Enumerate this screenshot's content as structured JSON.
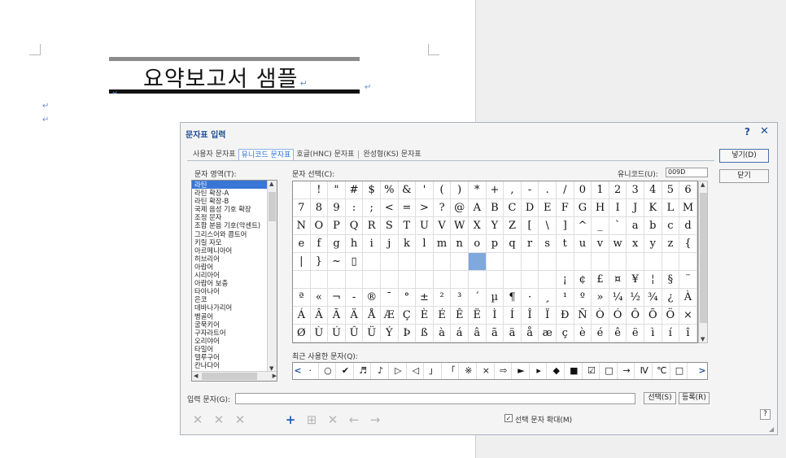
{
  "document": {
    "title": "요약보고서 샘플",
    "para_mark": "↵"
  },
  "dialog": {
    "title": "문자표 입력",
    "help": "?",
    "close": "✕",
    "tabs": [
      "사용자 문자표",
      "유니코드 문자표",
      "호글(HNC) 문자표",
      "완성형(KS) 문자표"
    ],
    "active_tab": 1,
    "insert_button": "넣기(D)",
    "close_button": "닫기",
    "area_label": "문자 영역(T):",
    "select_label": "문자 선택(C):",
    "unicode_label": "유니코드(U):",
    "unicode_value": "009D",
    "recent_label": "최근 사용한 문자(Q):",
    "input_label": "입력 문자(G):",
    "input_value": "",
    "select_button": "선택(S)",
    "register_button": "등록(R)",
    "zoom_label": "선택 문자 확대(M)",
    "zoom_checked": "✓",
    "corner_help": "?",
    "areas": [
      "라틴",
      "라틴 확장-A",
      "라틴 확장-B",
      "국제 음성 기호 확장",
      "조정 문자",
      "조합 분음 기호(악센트)",
      "그리스어와 콥트어",
      "키릴 자모",
      "아르메니아어",
      "히브리어",
      "아랍어",
      "시리아어",
      "아랍어 보충",
      "타아나어",
      "은코",
      "데바나가리어",
      "벵골어",
      "굴묵키어",
      "구자라트어",
      "오리야어",
      "타밀어",
      "텔루구어",
      "칸나다어"
    ],
    "selected_area": 0,
    "grid_rows": [
      [
        "",
        "!",
        "\"",
        "#",
        "$",
        "%",
        "&",
        "'",
        "(",
        ")",
        "*",
        "+",
        ",",
        "-",
        ".",
        "/",
        "0",
        "1",
        "2",
        "3",
        "4",
        "5",
        "6"
      ],
      [
        "7",
        "8",
        "9",
        ":",
        ";",
        "<",
        "=",
        ">",
        "?",
        "@",
        "A",
        "B",
        "C",
        "D",
        "E",
        "F",
        "G",
        "H",
        "I",
        "J",
        "K",
        "L",
        "M"
      ],
      [
        "N",
        "O",
        "P",
        "Q",
        "R",
        "S",
        "T",
        "U",
        "V",
        "W",
        "X",
        "Y",
        "Z",
        "[",
        "\\",
        "]",
        "^",
        "_",
        "`",
        "a",
        "b",
        "c",
        "d"
      ],
      [
        "e",
        "f",
        "g",
        "h",
        "i",
        "j",
        "k",
        "l",
        "m",
        "n",
        "o",
        "p",
        "q",
        "r",
        "s",
        "t",
        "u",
        "v",
        "w",
        "x",
        "y",
        "z",
        "{"
      ],
      [
        "|",
        "}",
        "~",
        "▯",
        "",
        "",
        "",
        "",
        "",
        "",
        "",
        "",
        "",
        "",
        "",
        "",
        "",
        "",
        "",
        "",
        "",
        "",
        ""
      ],
      [
        "",
        "",
        "",
        "",
        "",
        "",
        "",
        "",
        "",
        "",
        "",
        "",
        "",
        "",
        "",
        "¡",
        "¢",
        "£",
        "¤",
        "¥",
        "¦",
        "§",
        "¨",
        "©"
      ],
      [
        "ª",
        "«",
        "¬",
        "-",
        "®",
        "¯",
        "°",
        "±",
        "²",
        "³",
        "´",
        "µ",
        "¶",
        "·",
        "¸",
        "¹",
        "º",
        "»",
        "¼",
        "½",
        "¾",
        "¿",
        "À"
      ],
      [
        "Á",
        "Â",
        "Ã",
        "Ä",
        "Å",
        "Æ",
        "Ç",
        "È",
        "É",
        "Ê",
        "Ë",
        "Ì",
        "Í",
        "Î",
        "Ï",
        "Ð",
        "Ñ",
        "Ò",
        "Ó",
        "Ô",
        "Õ",
        "Ö",
        "×"
      ],
      [
        "Ø",
        "Ù",
        "Ú",
        "Û",
        "Ü",
        "Ý",
        "Þ",
        "ß",
        "à",
        "á",
        "â",
        "ã",
        "ä",
        "å",
        "æ",
        "ç",
        "è",
        "é",
        "ê",
        "ë",
        "ì",
        "í",
        "î"
      ]
    ],
    "selected_cell": [
      4,
      10
    ],
    "recent": [
      "·",
      "○",
      "✔",
      "♬",
      "♪",
      "▷",
      "◁",
      "」",
      "「",
      "※",
      "×",
      "⇨",
      "►",
      "▸",
      "◆",
      "■",
      "☑",
      "□",
      "→",
      "Ⅳ",
      "℃",
      "□"
    ],
    "tools": [
      "✕",
      "✕",
      "✕",
      "+",
      "⊞",
      "✕",
      "←",
      "→"
    ]
  }
}
